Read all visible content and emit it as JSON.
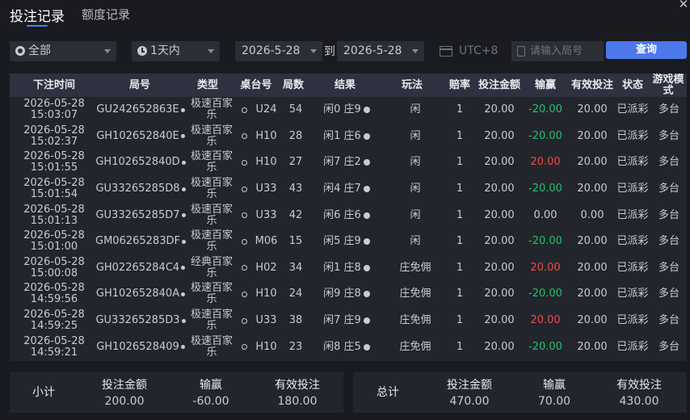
{
  "tabs": [
    {
      "label": "投注记录",
      "active": true
    },
    {
      "label": "额度记录",
      "active": false
    }
  ],
  "filters": {
    "game_type": "全部",
    "period": "1天内",
    "date_from": "2026-5-28",
    "date_to": "2026-5-28",
    "to_label": "到",
    "timezone": "UTC+8",
    "round_placeholder": "请输入局号",
    "query_label": "查询"
  },
  "table": {
    "headers": [
      "下注时间",
      "局号",
      "类型",
      "桌台号",
      "局数",
      "结果",
      "玩法",
      "赔率",
      "投注金额",
      "输赢",
      "有效投注",
      "状态",
      "游戏模式"
    ],
    "rows": [
      {
        "date": "2026-05-28",
        "time": "15:03:07",
        "round": "GU242652863E",
        "type": "极速百家乐",
        "table": "U24",
        "count": "54",
        "result": "闲0 庄9",
        "play": "闲",
        "odds": "1",
        "bet": "20.00",
        "win": "-20.00",
        "win_sign": "neg",
        "valid": "20.00",
        "status": "已派彩",
        "mode": "多台"
      },
      {
        "date": "2026-05-28",
        "time": "15:02:37",
        "round": "GH102652840E",
        "type": "极速百家乐",
        "table": "H10",
        "count": "28",
        "result": "闲1 庄6",
        "play": "闲",
        "odds": "1",
        "bet": "20.00",
        "win": "-20.00",
        "win_sign": "neg",
        "valid": "20.00",
        "status": "已派彩",
        "mode": "多台"
      },
      {
        "date": "2026-05-28",
        "time": "15:01:55",
        "round": "GH102652840D",
        "type": "极速百家乐",
        "table": "H10",
        "count": "27",
        "result": "闲7 庄2",
        "play": "闲",
        "odds": "1",
        "bet": "20.00",
        "win": "20.00",
        "win_sign": "pos",
        "valid": "20.00",
        "status": "已派彩",
        "mode": "多台"
      },
      {
        "date": "2026-05-28",
        "time": "15:01:54",
        "round": "GU33265285D8",
        "type": "极速百家乐",
        "table": "U33",
        "count": "43",
        "result": "闲4 庄7",
        "play": "闲",
        "odds": "1",
        "bet": "20.00",
        "win": "-20.00",
        "win_sign": "neg",
        "valid": "20.00",
        "status": "已派彩",
        "mode": "多台"
      },
      {
        "date": "2026-05-28",
        "time": "15:01:13",
        "round": "GU33265285D7",
        "type": "极速百家乐",
        "table": "U33",
        "count": "42",
        "result": "闲6 庄6",
        "play": "闲",
        "odds": "1",
        "bet": "20.00",
        "win": "0.00",
        "win_sign": "zero",
        "valid": "0.00",
        "status": "已派彩",
        "mode": "多台"
      },
      {
        "date": "2026-05-28",
        "time": "15:01:00",
        "round": "GM06265283DF",
        "type": "极速百家乐",
        "table": "M06",
        "count": "15",
        "result": "闲5 庄9",
        "play": "闲",
        "odds": "1",
        "bet": "20.00",
        "win": "-20.00",
        "win_sign": "neg",
        "valid": "20.00",
        "status": "已派彩",
        "mode": "多台"
      },
      {
        "date": "2026-05-28",
        "time": "15:00:08",
        "round": "GH02265284C4",
        "type": "经典百家乐",
        "table": "H02",
        "count": "34",
        "result": "闲1 庄8",
        "play": "庄免佣",
        "odds": "1",
        "bet": "20.00",
        "win": "20.00",
        "win_sign": "pos",
        "valid": "20.00",
        "status": "已派彩",
        "mode": "多台"
      },
      {
        "date": "2026-05-28",
        "time": "14:59:56",
        "round": "GH102652840A",
        "type": "极速百家乐",
        "table": "H10",
        "count": "24",
        "result": "闲9 庄8",
        "play": "庄免佣",
        "odds": "1",
        "bet": "20.00",
        "win": "-20.00",
        "win_sign": "neg",
        "valid": "20.00",
        "status": "已派彩",
        "mode": "多台"
      },
      {
        "date": "2026-05-28",
        "time": "14:59:25",
        "round": "GU33265285D3",
        "type": "极速百家乐",
        "table": "U33",
        "count": "38",
        "result": "闲7 庄9",
        "play": "庄免佣",
        "odds": "1",
        "bet": "20.00",
        "win": "20.00",
        "win_sign": "pos",
        "valid": "20.00",
        "status": "已派彩",
        "mode": "多台"
      },
      {
        "date": "2026-05-28",
        "time": "14:59:21",
        "round": "GH1026528409",
        "type": "极速百家乐",
        "table": "H10",
        "count": "23",
        "result": "闲8 庄5",
        "play": "庄免佣",
        "odds": "1",
        "bet": "20.00",
        "win": "-20.00",
        "win_sign": "neg",
        "valid": "20.00",
        "status": "已派彩",
        "mode": "多台"
      }
    ]
  },
  "subtotal": {
    "label": "小计",
    "bet_label": "投注金额",
    "bet": "200.00",
    "win_label": "输赢",
    "win": "-60.00",
    "valid_label": "有效投注",
    "valid": "180.00"
  },
  "total": {
    "label": "总计",
    "bet_label": "投注金额",
    "bet": "470.00",
    "win_label": "输赢",
    "win": "70.00",
    "valid_label": "有效投注",
    "valid": "430.00"
  },
  "colors": {
    "accent": "#4c78ec",
    "loss": "#1fc26b",
    "win": "#f04a4a"
  },
  "icons": [
    "close-icon",
    "filter-icon",
    "clock-icon",
    "chevron-down-icon",
    "calendar-icon",
    "search-icon",
    "copy-icon",
    "table-dot-icon",
    "info-icon"
  ]
}
